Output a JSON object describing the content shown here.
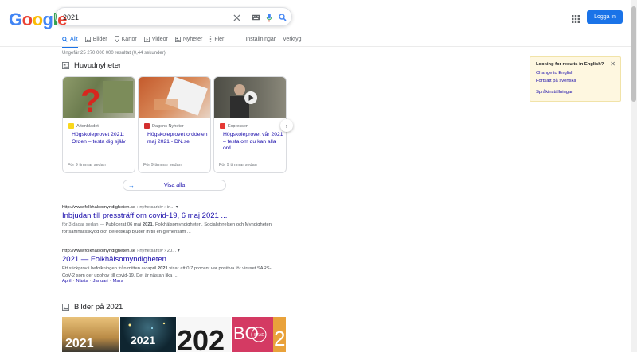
{
  "logo": {
    "text": "Google",
    "letters": [
      {
        "ch": "G",
        "color": "#4285f4"
      },
      {
        "ch": "o",
        "color": "#ea4335"
      },
      {
        "ch": "o",
        "color": "#fbbc05"
      },
      {
        "ch": "g",
        "color": "#4285f4"
      },
      {
        "ch": "l",
        "color": "#34a853"
      },
      {
        "ch": "e",
        "color": "#ea4335"
      }
    ]
  },
  "search": {
    "query": "2021",
    "clear_icon": "close-icon",
    "keyboard_icon": "keyboard-icon",
    "mic_icon": "mic-icon",
    "search_icon": "search-icon"
  },
  "header": {
    "login_label": "Logga in",
    "apps_icon": "apps-grid-icon",
    "accent": "#1a73e8"
  },
  "tabs": [
    {
      "label": "Allt",
      "icon": "search-icon",
      "active": true
    },
    {
      "label": "Bilder",
      "icon": "image-icon"
    },
    {
      "label": "Kartor",
      "icon": "map-pin-icon"
    },
    {
      "label": "Videor",
      "icon": "video-icon"
    },
    {
      "label": "Nyheter",
      "icon": "news-icon"
    },
    {
      "label": "Fler",
      "icon": "more-icon"
    },
    {
      "label": "Inställningar"
    },
    {
      "label": "Verktyg"
    }
  ],
  "result_stats": "Ungefär 25 270 000 000 resultat (0,44 sekunder)",
  "top_stories": {
    "title": "Huvudnyheter",
    "cards": [
      {
        "source": "Aftonbladet",
        "source_color": "#fdd835",
        "title": "Högskoleprovet 2021: Orden – testa dig själv",
        "time": "För 9 timmar sedan"
      },
      {
        "source": "Dagens Nyheter",
        "source_color": "#d32f2f",
        "title": "Högskoleprovet orddelen maj 2021 - DN.se",
        "time": "För 9 timmar sedan"
      },
      {
        "source": "Expressen",
        "source_color": "#e53935",
        "title": "Högskoleprovet vår 2021 – testa om du kan alla ord",
        "time": "För 9 timmar sedan"
      }
    ],
    "view_all": "Visa alla"
  },
  "results": [
    {
      "url": "http://www.folkhalsomyndigheten.se",
      "crumb": "› nyhetsarkiv › in...",
      "title": "Inbjudan till pressträff om covid-19, 6 maj 2021 ...",
      "meta": "för 3 dagar sedan —",
      "snippet_a": " Publicerat 06 maj ",
      "snippet_bold": "2021",
      "snippet_b": ". Folkhälsomyndigheten, Socialstyrelsen och Myndigheten för samhällsskydd och beredskap bjuder in till en gemensam ..."
    },
    {
      "url": "http://www.folkhalsomyndigheten.se",
      "crumb": "› nyhetsarkiv › 20...",
      "title": "2021 — Folkhälsomyndigheten",
      "snippet_a": "Ett stickprov i befolkningen från mitten av april ",
      "snippet_bold": "2021",
      "snippet_b": " visar att 0,7 procent var positiva för viruset SARS-CoV-2 som ger upphov till covid-19. Det är nästan lika ...",
      "sitelinks": [
        "April",
        "Nästa",
        "Januari",
        "Mars"
      ]
    }
  ],
  "images_section": {
    "title": "Bilder på 2021",
    "thumbs": [
      "2021",
      "2021",
      "202",
      "BO STAD 2"
    ]
  },
  "language_panel": {
    "heading": "Looking for results in English?",
    "change": "Change to English",
    "keep": "Fortsätt på svenska",
    "settings": "Språkinställningar"
  }
}
